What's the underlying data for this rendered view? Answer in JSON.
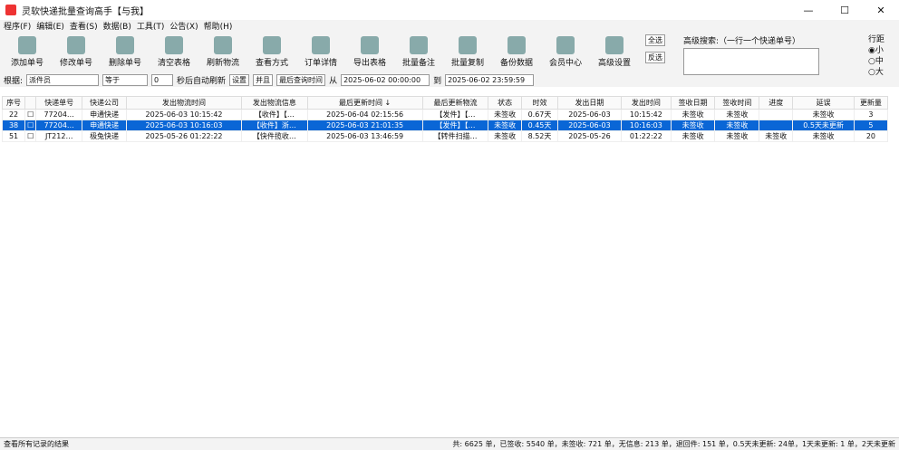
{
  "title": "灵软快递批量查询高手【与我】",
  "menu": [
    "程序(F)",
    "编辑(E)",
    "查看(S)",
    "数据(B)",
    "工具(T)",
    "公告(X)",
    "帮助(H)"
  ],
  "toolbar": [
    "添加单号",
    "修改单号",
    "删除单号",
    "清空表格",
    "刷新物流",
    "查看方式",
    "订单详情",
    "导出表格",
    "批量备注",
    "批量复制",
    "备份数据",
    "会员中心",
    "高级设置"
  ],
  "filter": {
    "root": "根据:",
    "field": "派件员",
    "op": "等于",
    "num": "0",
    "auto": "秒后自动刷新",
    "set": "设置",
    "and": "并且",
    "time": "最后查询时间",
    "from": "从",
    "date1": "2025-06-02 00:00:00",
    "to": "到",
    "date2": "2025-06-02 23:59:59"
  },
  "adv": {
    "label": "高级搜索:（一行一个快递单号）",
    "all": "全选",
    "inv": "反选",
    "spacing": "行距",
    "small": "小",
    "mid": "中",
    "large": "大"
  },
  "columns": [
    "序号",
    "",
    "快递单号",
    "快递公司",
    "发出物流时间",
    "发出物流信息",
    "最后更新时间 ↓",
    "最后更新物流",
    "状态",
    "时效",
    "发出日期",
    "发出时间",
    "签收日期",
    "签收时间",
    "进度",
    "延误",
    "更新量"
  ],
  "rows": [
    [
      "22",
      "77204…",
      "申通快递",
      "2025-06-03 10:15:42",
      "【收件】【…",
      "2025-06-04 02:15:56",
      "【发件】【…",
      "未签收",
      "0.67天",
      "2025-06-03",
      "10:15:42",
      "未签收",
      "未签收",
      "",
      "未签收",
      "3"
    ],
    [
      "38",
      "77204…",
      "申通快递",
      "2025-06-03 10:16:03",
      "【收件】浙…",
      "2025-06-03 21:01:35",
      "【发件】【…",
      "未签收",
      "0.45天",
      "2025-06-03",
      "10:16:03",
      "未签收",
      "未签收",
      "",
      "0.5天未更新",
      "5"
    ],
    [
      "51",
      "JT212…",
      "极兔快递",
      "2025-05-26 01:22:22",
      "【快件揽收…",
      "2025-06-03 13:46:59",
      "【转件扫描…",
      "未签收",
      "8.52天",
      "2025-05-26",
      "01:22:22",
      "未签收",
      "未签收",
      "未签收",
      "未签收",
      "20"
    ]
  ],
  "selected_index": 1,
  "status": {
    "left": "查看所有记录的结果",
    "right": "共: 6625 单，已签收: 5540 单，未签收: 721 单，无信息: 213 单，退回件: 151 单，0.5天未更新: 24单，1天未更新: 1 单，2天未更新"
  }
}
